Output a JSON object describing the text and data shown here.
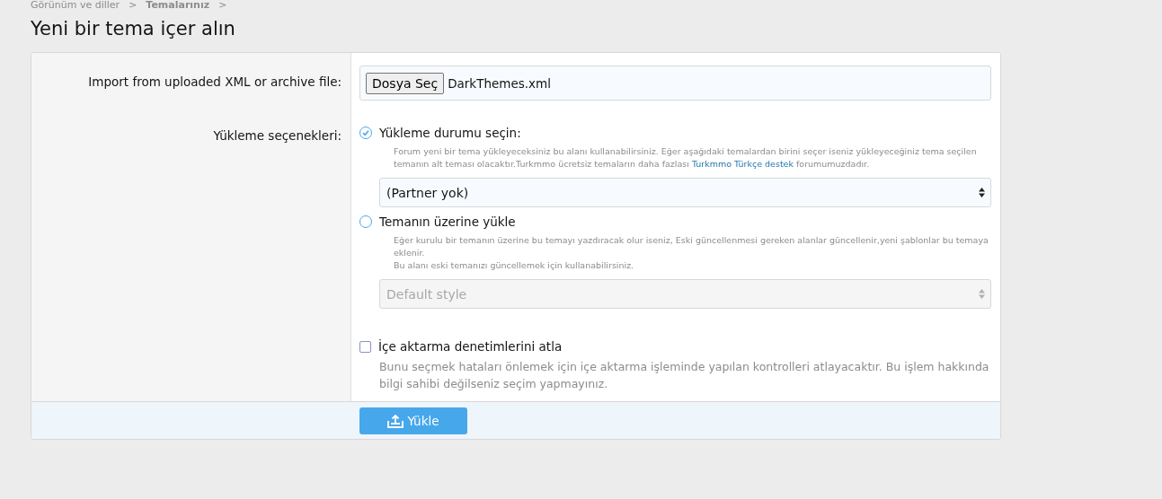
{
  "breadcrumb": [
    {
      "label": "Görünüm ve diller",
      "bold": false
    },
    {
      "label": "Temalarınız",
      "bold": true
    }
  ],
  "breadcrumb_separator": ">",
  "page_title": "Yeni bir tema içer alın",
  "form": {
    "rows": [
      {
        "kind": "file",
        "label": "Import from uploaded XML or archive file:",
        "button": "Dosya Seç",
        "value": "DarkThemes.xml"
      },
      {
        "kind": "options",
        "label": "Yükleme seçenekleri:",
        "options": [
          {
            "label": "Yükleme durumu seçin:",
            "selected": true,
            "hint": [
              [
                {
                  "kind": "text",
                  "text": "Forum yeni bir tema yükleyeceksiniz bu alanı kullanabilirsiniz. Eğer aşağıdaki temalardan birini seçer iseniz yükleyeceğiniz tema seçilen temanın alt teması olacaktır.Turkmmo ücretsiz temaların daha fazlası "
                },
                {
                  "kind": "link",
                  "text": "Turkmmo Türkçe destek"
                },
                {
                  "kind": "text",
                  "text": " forumumuzdadır."
                }
              ]
            ],
            "select": {
              "value": "(Partner yok)",
              "disabled": false
            }
          },
          {
            "label": "Temanın üzerine yükle",
            "selected": false,
            "hint": [
              [
                {
                  "kind": "text",
                  "text": "Eğer kurulu bir temanın üzerine bu temayı yazdıracak olur iseniz, Eski güncellenmesi gereken alanlar güncellenir,yeni şablonlar bu temaya eklenir."
                }
              ],
              [
                {
                  "kind": "text",
                  "text": "Bu alanı eski temanızı güncellemek için kullanabilirsiniz."
                }
              ]
            ],
            "select": {
              "value": "Default style",
              "disabled": true
            }
          }
        ]
      },
      {
        "kind": "checkbox",
        "label": "İçe aktarma denetimlerini atla",
        "checked": false,
        "hint": "Bunu seçmek hataları önlemek için içe aktarma işleminde yapılan kontrolleri atlayacaktır. Bu işlem hakkında bilgi sahibi değilseniz seçim yapmayınız."
      }
    ],
    "submit": "Yükle"
  }
}
